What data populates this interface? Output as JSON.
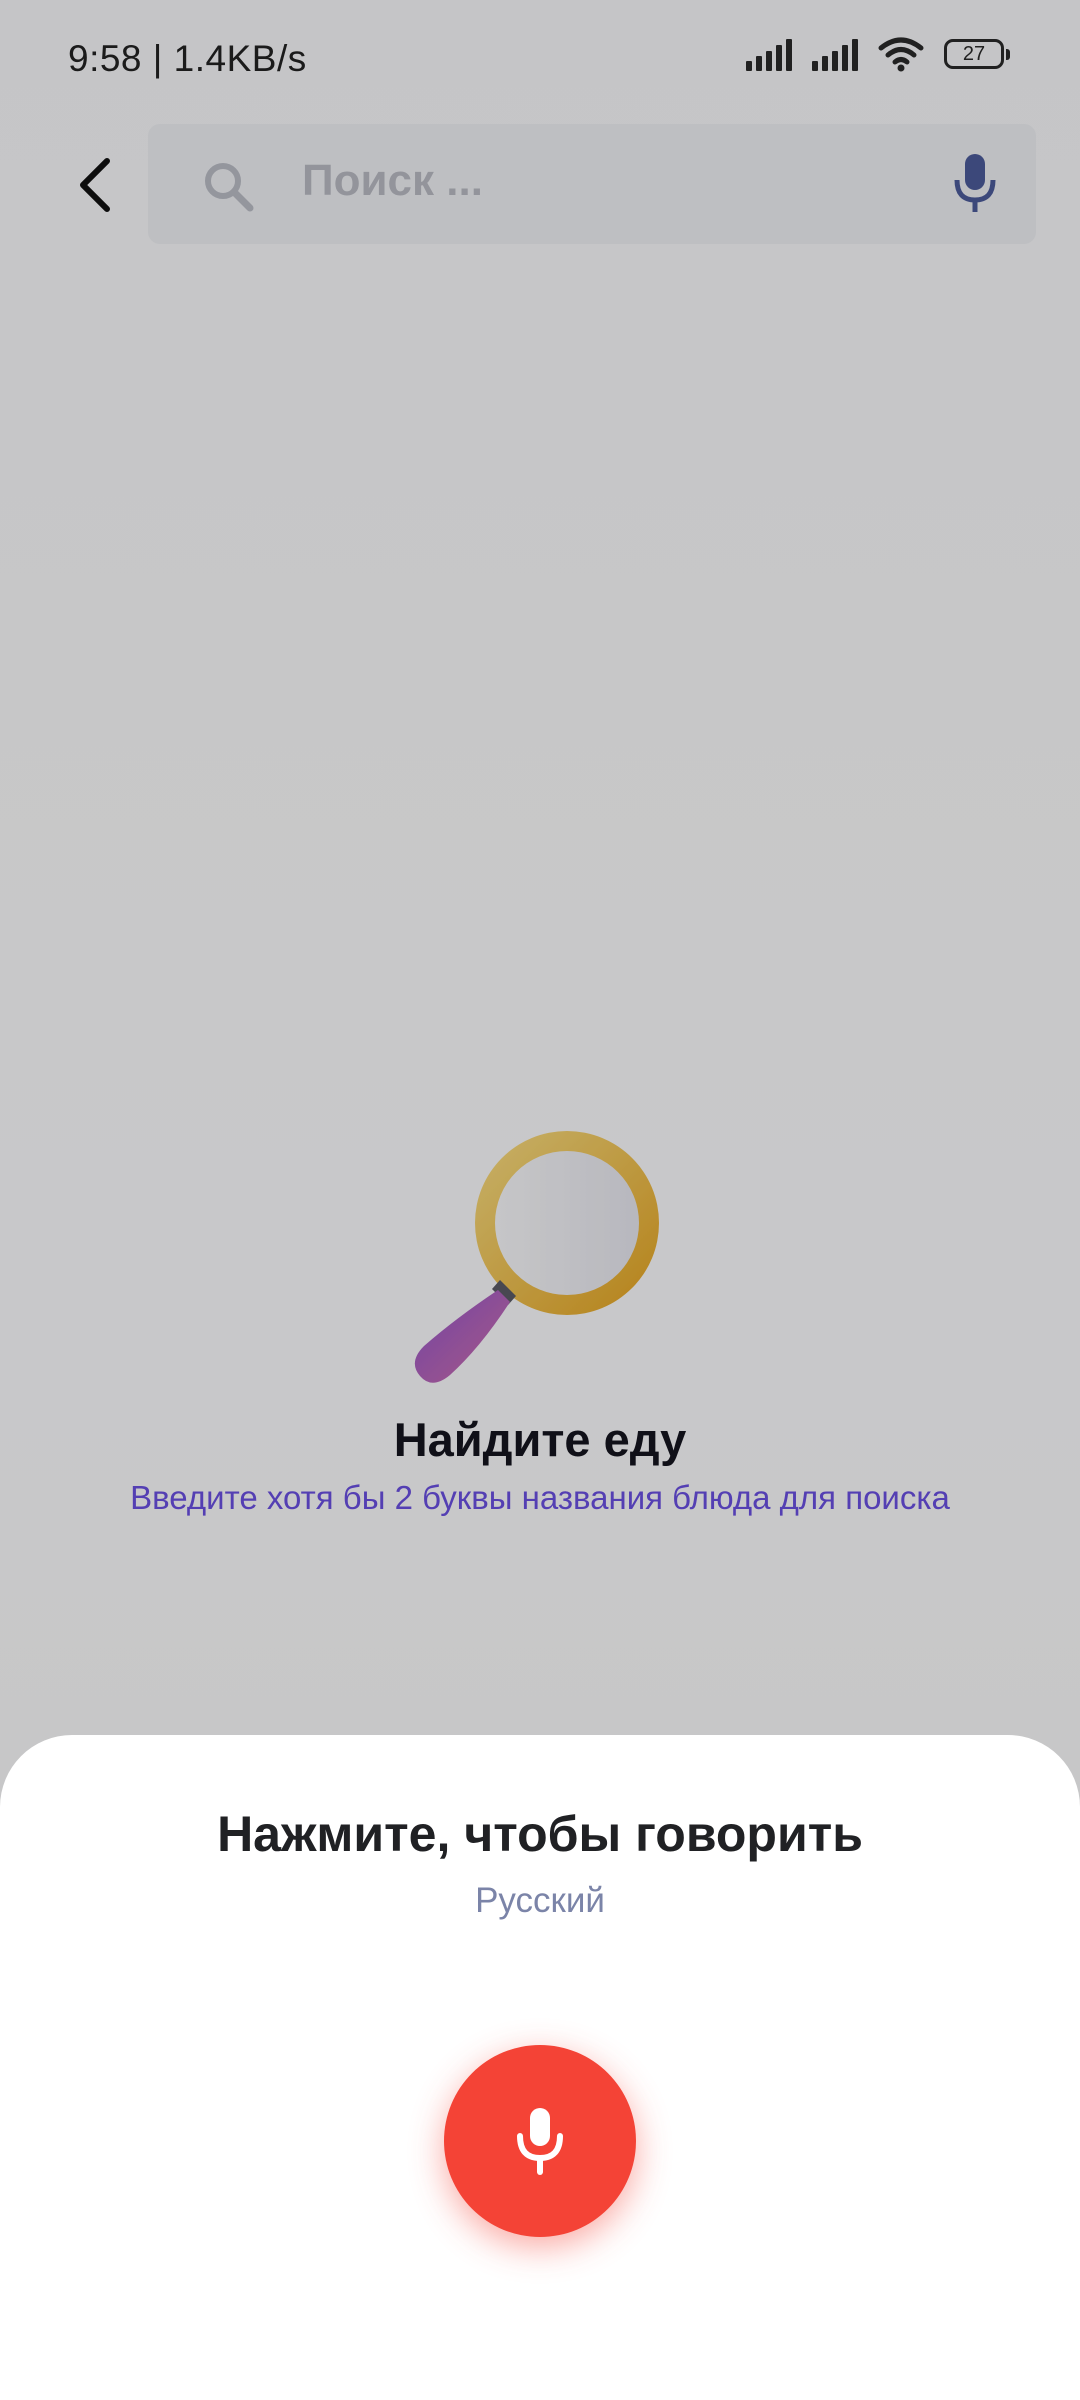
{
  "status_bar": {
    "time_speed": "9:58 | 1.4KB/s",
    "battery_level": "27",
    "icons": [
      "signal-icon",
      "signal-icon",
      "wifi-icon",
      "battery-icon"
    ]
  },
  "header": {
    "back_icon": "back-arrow-icon",
    "search": {
      "placeholder": "Поиск ...",
      "search_icon": "search-icon",
      "mic_icon": "mic-icon"
    }
  },
  "empty_state": {
    "illustration": "magnifying-glass-icon",
    "title": "Найдите еду",
    "subtitle": "Введите хотя бы 2 буквы названия блюда для поиска"
  },
  "voice_sheet": {
    "title": "Нажмите, чтобы говорить",
    "language": "Русский",
    "mic_button_icon": "mic-icon"
  },
  "colors": {
    "accent_purple": "#6a4fe0",
    "mic_button_red": "#f44336",
    "mic_icon_blue": "#4b5a99",
    "language_gray_blue": "#7b84a8"
  }
}
